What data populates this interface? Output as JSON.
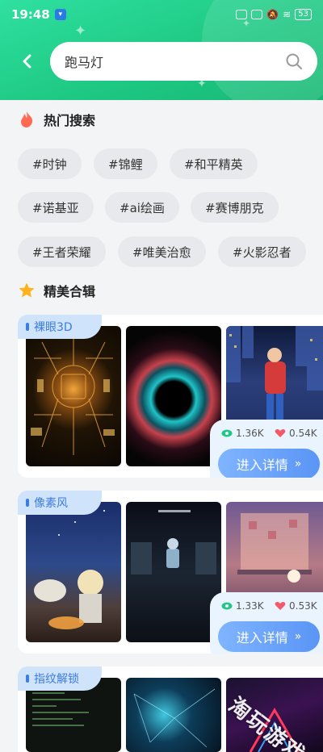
{
  "status_bar": {
    "time": "19:48",
    "battery": "53"
  },
  "search": {
    "query": "跑马灯"
  },
  "hot_search": {
    "title": "热门搜索",
    "tags": [
      "#时钟",
      "#锦鲤",
      "#和平精英",
      "#诺基亚",
      "#ai绘画",
      "#赛博朋克",
      "#王者荣耀",
      "#唯美治愈",
      "#火影忍者"
    ]
  },
  "collections": {
    "title": "精美合辑",
    "cards": [
      {
        "tag": "裸眼3D",
        "views": "1.36K",
        "likes": "0.54K",
        "button": "进入详情"
      },
      {
        "tag": "像素风",
        "views": "1.33K",
        "likes": "0.53K",
        "button": "进入详情"
      },
      {
        "tag": "指纹解锁"
      }
    ]
  },
  "watermark": "淘玩游戏",
  "colors": {
    "header_green": "#1ec983",
    "accent_blue": "#5a95f5",
    "tag_blue": "#3d7ddf"
  }
}
